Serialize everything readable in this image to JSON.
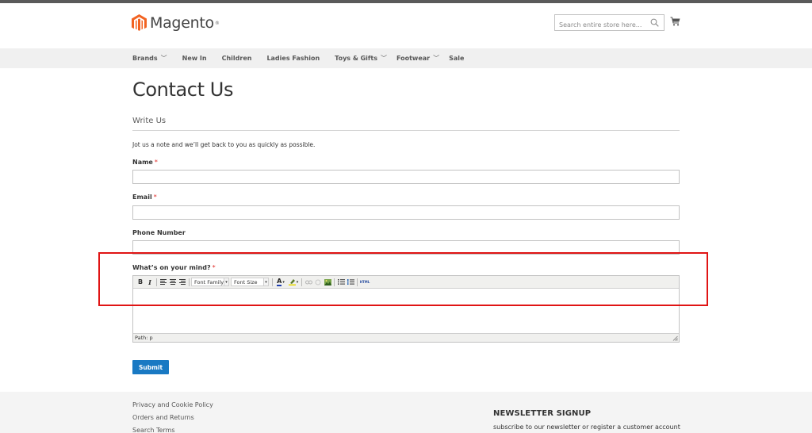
{
  "header": {
    "logo_text": "Magento",
    "logo_tm": "®",
    "search_placeholder": "Search entire store here...",
    "brand_color": "#f26322"
  },
  "nav": {
    "items": [
      {
        "label": "Brands",
        "has_dropdown": true
      },
      {
        "label": "New In",
        "has_dropdown": false
      },
      {
        "label": "Children",
        "has_dropdown": false
      },
      {
        "label": "Ladies Fashion",
        "has_dropdown": false
      },
      {
        "label": "Toys & Gifts",
        "has_dropdown": true
      },
      {
        "label": "Footwear",
        "has_dropdown": true
      },
      {
        "label": "Sale",
        "has_dropdown": false
      }
    ]
  },
  "page": {
    "title": "Contact Us",
    "legend": "Write Us",
    "intro": "Jot us a note and we’ll get back to you as quickly as possible."
  },
  "form": {
    "name_label": "Name",
    "email_label": "Email",
    "phone_label": "Phone Number",
    "comment_label": "What’s on your mind?",
    "required_mark": "*",
    "submit_label": "Submit",
    "name_value": "",
    "email_value": "",
    "phone_value": ""
  },
  "editor": {
    "bold": "B",
    "italic": "I",
    "font_family": "Font Family",
    "font_size": "Font Size",
    "font_color": "A",
    "html": "HTML",
    "path": "Path: p"
  },
  "footer": {
    "links": [
      "Privacy and Cookie Policy",
      "Orders and Returns",
      "Search Terms"
    ],
    "newsletter_title": "NEWSLETTER SIGNUP",
    "newsletter_text": "subscribe to our newsletter or register a customer account"
  },
  "colors": {
    "accent": "#1979c3",
    "required": "#e02b27",
    "highlight": "#e01414"
  }
}
